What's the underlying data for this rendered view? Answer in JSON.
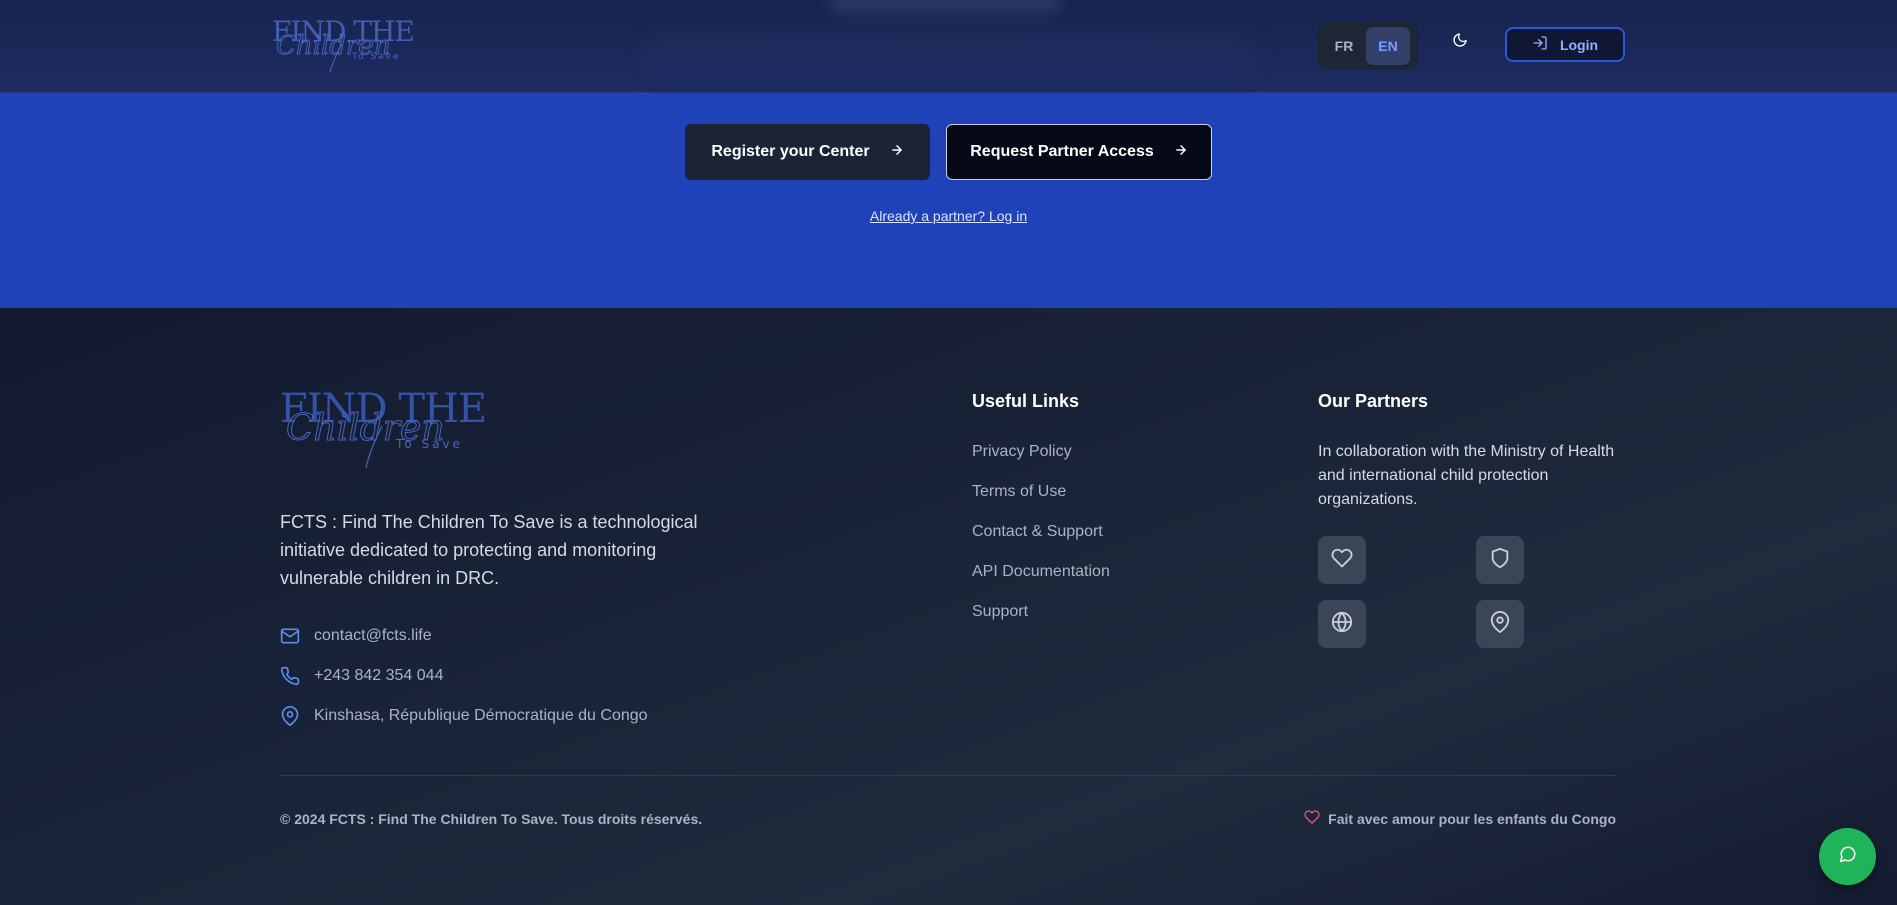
{
  "header": {
    "logo": {
      "line1": "FIND THE",
      "script": "Children",
      "line3": "To Save",
      "icon": "fcts-logo"
    },
    "languages": [
      {
        "label": "FR",
        "active": false
      },
      {
        "label": "EN",
        "active": true
      }
    ],
    "theme_icon": "moon-icon",
    "login_label": "Login",
    "login_icon": "log-in-icon"
  },
  "cta": {
    "register_label": "Register your Center",
    "partner_label": "Request Partner Access",
    "button_icon": "arrow-right-icon",
    "already_partner_link": "Already a partner? Log in"
  },
  "footer": {
    "logo": {
      "line1": "FIND THE",
      "script": "Children",
      "line3": "To Save"
    },
    "about": "FCTS : Find The Children To Save is a technological initiative dedicated to protecting and monitoring vulnerable children in DRC.",
    "contacts": [
      {
        "icon": "mail-icon",
        "text": "contact@fcts.life"
      },
      {
        "icon": "phone-icon",
        "text": "+243 842 354 044"
      },
      {
        "icon": "map-pin-icon",
        "text": "Kinshasa, République Démocratique du Congo"
      }
    ],
    "useful_links": {
      "title": "Useful Links",
      "items": [
        "Privacy Policy",
        "Terms of Use",
        "Contact & Support",
        "API Documentation",
        "Support"
      ]
    },
    "partners": {
      "title": "Our Partners",
      "text": "In collaboration with the Ministry of Health and international child protection organizations.",
      "icons": [
        "heart-icon",
        "shield-icon",
        "globe-icon",
        "map-pin-icon"
      ]
    },
    "copyright": "© 2024 FCTS : Find The Children To Save. Tous droits réservés.",
    "made_with": "Fait avec amour pour les enfants du Congo",
    "made_with_icon": "heart-icon"
  },
  "chat": {
    "icon": "message-circle-icon"
  },
  "colors": {
    "accent": "#1f42b8",
    "login_border": "#2b57d6",
    "icon_blue": "#6fa0ff",
    "chat_green": "#1fb45a",
    "heart_red": "#f0506e"
  }
}
